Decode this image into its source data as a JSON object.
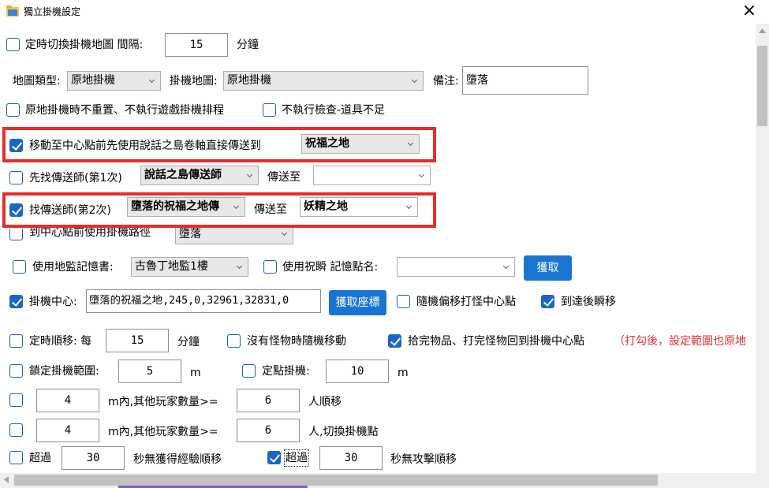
{
  "window": {
    "title": "獨立掛機設定",
    "close_label": "×"
  },
  "row1": {
    "timed_switch_label": "定時切換掛機地圖 間隔:",
    "interval_value": "15",
    "minutes_label": "分鐘",
    "checked": false
  },
  "row2": {
    "map_type_label": "地圖類型:",
    "map_type_value": "原地掛機",
    "hang_map_label": "掛機地圖:",
    "hang_map_value": "原地掛機",
    "note_label": "備注:",
    "note_value": "墮落"
  },
  "row3": {
    "no_reset_label": "原地掛機時不重置、不執行遊戲掛機排程",
    "no_reset_checked": false,
    "no_check_label": "不執行檢查-道具不足",
    "no_check_checked": false
  },
  "row4": {
    "label": "移動至中心點前先使用說話之島卷軸直接傳送到",
    "checked": true,
    "dest_value": "祝福之地"
  },
  "row5": {
    "label": "先找傳送師(第1次)",
    "checked": false,
    "npc_value": "說話之島傳送師",
    "to_label": "傳送至",
    "dest_value": ""
  },
  "row6": {
    "label": "找傳送師(第2次)",
    "checked": true,
    "npc_value": "墮落的祝福之地傳",
    "to_label": "傳送至",
    "dest_value": "妖精之地"
  },
  "row7": {
    "label": "到中心點前使用掛機路徑",
    "checked": false,
    "path_value": "墮落"
  },
  "row8": {
    "dungeon_scroll_label": "使用地監記憶書:",
    "dungeon_scroll_checked": false,
    "dungeon_scroll_value": "古魯丁地監1樓",
    "blink_label": "使用祝瞬 記憶點名:",
    "blink_checked": false,
    "blink_value": "",
    "fetch_button": "獲取"
  },
  "row9": {
    "center_label": "掛機中心:",
    "center_checked": true,
    "center_value": "墮落的祝福之地,245,0,32961,32831,0",
    "fetch_coords_button": "獲取座標",
    "random_offset_label": "隨機偏移打怪中心點",
    "random_offset_checked": false,
    "teleport_label": "到達後瞬移",
    "teleport_checked": true
  },
  "row10": {
    "timed_move_label": "定時順移: 每",
    "timed_move_checked": false,
    "timed_move_value": "15",
    "minutes_label": "分鐘",
    "no_monster_label": "沒有怪物時隨機移動",
    "no_monster_checked": false,
    "return_center_label": "拾完物品、打完怪物回到掛機中心點",
    "return_center_checked": true,
    "note_red": "（打勾後，設定範圍也原地"
  },
  "row11": {
    "lock_range_label": "鎖定掛機範圍:",
    "lock_range_checked": false,
    "lock_range_value": "5",
    "unit_m": "m",
    "fixed_point_label": "定點掛機:",
    "fixed_point_checked": false,
    "fixed_point_value": "10",
    "unit_m2": "m"
  },
  "row12": {
    "checked": false,
    "distance_value": "4",
    "mid_label": "m內,其他玩家數量>=",
    "count_value": "6",
    "action_label": "人順移"
  },
  "row13": {
    "checked": false,
    "distance_value": "4",
    "mid_label": "m內,其他玩家數量>=",
    "count_value": "6",
    "action_label": "人,切換掛機點"
  },
  "row14": {
    "exceed_label": "超過",
    "exceed_checked": false,
    "exceed_value": "30",
    "no_exp_label": "秒無獲得經驗順移",
    "exceed2_label": "超過",
    "exceed2_checked": true,
    "exceed2_value": "30",
    "no_attack_label": "秒無攻擊順移"
  },
  "colors": {
    "accent": "#1a75d2",
    "highlight_border": "#ea2b2b",
    "checkbox_checked": "#1a66c8"
  }
}
